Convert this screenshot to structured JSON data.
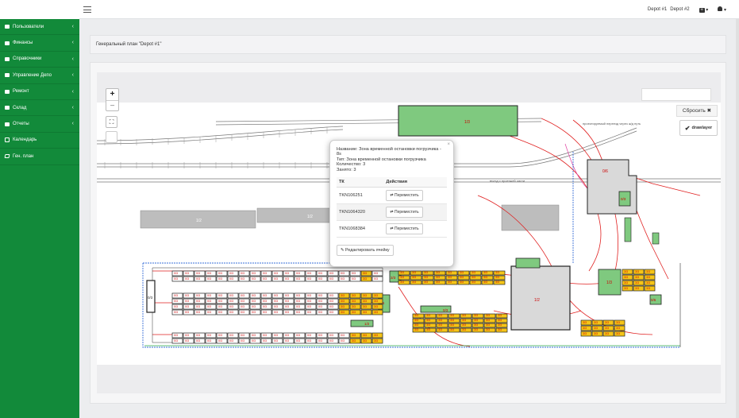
{
  "sidebar": {
    "items": [
      {
        "label": "Пользователи",
        "icon": "folder-icon",
        "has_children": true
      },
      {
        "label": "Финансы",
        "icon": "folder-icon",
        "has_children": true
      },
      {
        "label": "Справочники",
        "icon": "folder-icon",
        "has_children": true
      },
      {
        "label": "Управление Депо",
        "icon": "folder-icon",
        "has_children": true
      },
      {
        "label": "Ремонт",
        "icon": "folder-icon",
        "has_children": true
      },
      {
        "label": "Склад",
        "icon": "folder-icon",
        "has_children": true
      },
      {
        "label": "Отчеты",
        "icon": "folder-icon",
        "has_children": true
      },
      {
        "label": "Календарь",
        "icon": "calendar-icon",
        "has_children": false
      },
      {
        "label": "Ген. план",
        "icon": "map-icon",
        "has_children": false
      }
    ],
    "chevron": "‹"
  },
  "topbar": {
    "depots": [
      "Depot #1",
      "Depot #2"
    ],
    "caret": "▾"
  },
  "page": {
    "title": "Генеральный план \"Depot #1\""
  },
  "map": {
    "zoom_in": "+",
    "zoom_out": "−",
    "fullscreen": "⛶",
    "reset_label": "Сбросить ✖",
    "drawlayer_label": "drawlayer",
    "labels": {
      "top_block": "1/3",
      "warehouse_top": "0/6",
      "warehouse_small": "0/3",
      "hall_center": "1/2",
      "right_block": "1/3",
      "left_block": "0/3",
      "mid_block": "3/3",
      "mid_small": "3/6",
      "right_small": "0/6",
      "rail_car_a": "1/2",
      "rail_car_b": "1/2",
      "bottom_small": "1/2",
      "mid_top": "0/3",
      "cell": "0/3",
      "cell_filled": "3/3"
    },
    "notes": [
      "проектируемый переезд через ж/д путь",
      "въезд с проезжей части"
    ]
  },
  "popup": {
    "close": "×",
    "name_line": "Название: Зона временной остановки погрузчика - 8s",
    "type_line": "Тип: Зона временной остановки погрузчика",
    "count_line": "Количество: 3",
    "occupied_line": "Занято: 3",
    "col_tk": "ТК",
    "col_actions": "Действия",
    "rows": [
      {
        "tk": "TKN106251",
        "action": "⇄ Переместить"
      },
      {
        "tk": "TKN1064320",
        "action": "⇄ Переместить"
      },
      {
        "tk": "TKN1068384",
        "action": "⇄ Переместить"
      }
    ],
    "edit_label": "✎ Редактировать ячейку"
  },
  "colors": {
    "sidebar": "#128a3a",
    "slot_yellow": "#f5c518",
    "slot_green": "#7fc97f",
    "route_red": "#e02020",
    "fence_blue": "#3a6fd8"
  }
}
